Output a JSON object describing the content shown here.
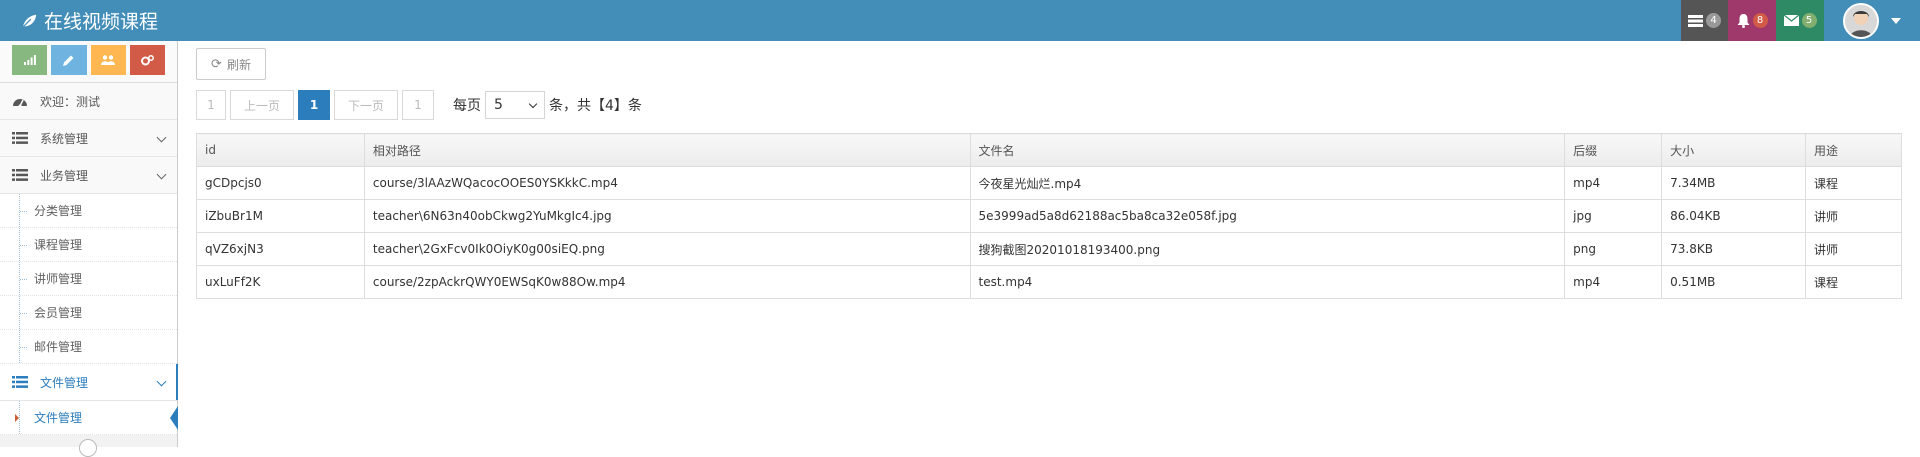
{
  "app": {
    "title": "在线视频课程"
  },
  "navbar": {
    "tasks_count": "4",
    "notifications_count": "8",
    "messages_count": "5",
    "colors": {
      "bar": "#438eb9",
      "tasks": "#555555",
      "notifications": "#a0396b",
      "messages": "#2e8965"
    }
  },
  "shortcuts": [
    {
      "icon": "signal-icon",
      "color": "#87b87f"
    },
    {
      "icon": "pencil-icon",
      "color": "#6fb3e0"
    },
    {
      "icon": "users-icon",
      "color": "#ffb752"
    },
    {
      "icon": "cogs-icon",
      "color": "#d15b47"
    }
  ],
  "sidebar": {
    "welcome": "欢迎：测试",
    "system": "系统管理",
    "business": "业务管理",
    "business_items": [
      "分类管理",
      "课程管理",
      "讲师管理",
      "会员管理",
      "邮件管理"
    ],
    "file": "文件管理",
    "file_items": [
      "文件管理"
    ]
  },
  "toolbar": {
    "refresh_label": "刷新"
  },
  "pager": {
    "first": "1",
    "prev": "上一页",
    "current": "1",
    "next": "下一页",
    "last": "1",
    "per_page_label": "每页",
    "per_page_value": "5",
    "total_text": "条，共【4】条"
  },
  "table": {
    "headers": [
      "id",
      "相对路径",
      "文件名",
      "后缀",
      "大小",
      "用途"
    ],
    "rows": [
      [
        "gCDpcjs0",
        "course/3lAAzWQacocOOES0YSKkkC.mp4",
        "今夜星光灿烂.mp4",
        "mp4",
        "7.34MB",
        "课程"
      ],
      [
        "iZbuBr1M",
        "teacher\\6N63n40obCkwg2YuMkgIc4.jpg",
        "5e3999ad5a8d62188ac5ba8ca32e058f.jpg",
        "jpg",
        "86.04KB",
        "讲师"
      ],
      [
        "qVZ6xjN3",
        "teacher\\2GxFcv0Ik0OiyK0g00siEQ.png",
        "搜狗截图20201018193400.png",
        "png",
        "73.8KB",
        "讲师"
      ],
      [
        "uxLuFf2K",
        "course/2zpAckrQWY0EWSqK0w88Ow.mp4",
        "test.mp4",
        "mp4",
        "0.51MB",
        "课程"
      ]
    ]
  }
}
